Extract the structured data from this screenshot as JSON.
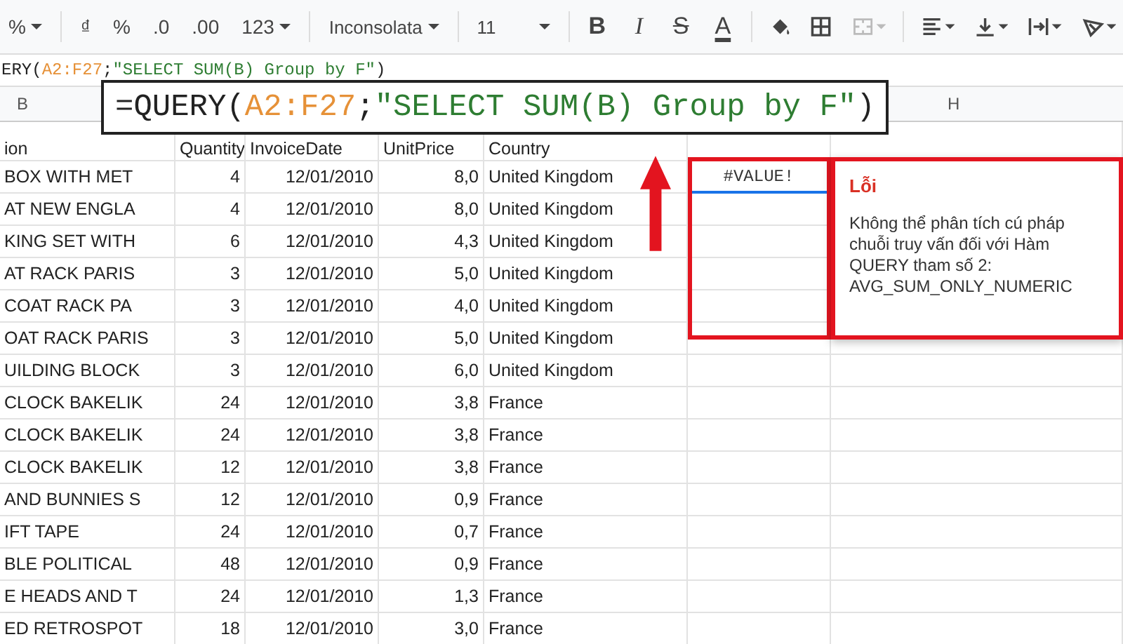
{
  "toolbar": {
    "zoom": "%",
    "number_formats": [
      "₫",
      "%",
      ".0",
      ".00"
    ],
    "format_menu": "123",
    "font": "Inconsolata",
    "font_size": "11",
    "text_styles": [
      "B",
      "I",
      "S",
      "A"
    ],
    "merge": {
      "disabled": true
    }
  },
  "formula_bar": {
    "parts": [
      {
        "kind": "plain",
        "text": "ERY("
      },
      {
        "kind": "range",
        "text": "A2:F27"
      },
      {
        "kind": "plain",
        "text": ";"
      },
      {
        "kind": "string",
        "text": "\"SELECT SUM(B) Group by F\""
      },
      {
        "kind": "plain",
        "text": ")"
      }
    ]
  },
  "callout": {
    "parts": [
      {
        "kind": "plain",
        "text": "=QUERY("
      },
      {
        "kind": "range",
        "text": "A2:F27"
      },
      {
        "kind": "plain",
        "text": ";"
      },
      {
        "kind": "string",
        "text": "\"SELECT SUM(B) Group by F\""
      },
      {
        "kind": "plain",
        "text": ")"
      }
    ]
  },
  "column_headers": [
    {
      "label": "B"
    },
    {
      "label": "H"
    }
  ],
  "table": {
    "columns": [
      "ion",
      "Quantity",
      "InvoiceDate",
      "UnitPrice",
      "Country"
    ],
    "rows": [
      [
        "BOX WITH MET",
        "4",
        "12/01/2010",
        "8,0",
        "United Kingdom"
      ],
      [
        "AT NEW ENGLA",
        "4",
        "12/01/2010",
        "8,0",
        "United Kingdom"
      ],
      [
        "KING SET WITH",
        "6",
        "12/01/2010",
        "4,3",
        "United Kingdom"
      ],
      [
        "AT RACK PARIS",
        "3",
        "12/01/2010",
        "5,0",
        "United Kingdom"
      ],
      [
        "COAT RACK PA",
        "3",
        "12/01/2010",
        "4,0",
        "United Kingdom"
      ],
      [
        "OAT RACK PARIS",
        "3",
        "12/01/2010",
        "5,0",
        "United Kingdom"
      ],
      [
        "UILDING BLOCK",
        "3",
        "12/01/2010",
        "6,0",
        "United Kingdom"
      ],
      [
        "CLOCK BAKELIK",
        "24",
        "12/01/2010",
        "3,8",
        "France"
      ],
      [
        "CLOCK BAKELIK",
        "24",
        "12/01/2010",
        "3,8",
        "France"
      ],
      [
        "CLOCK BAKELIK",
        "12",
        "12/01/2010",
        "3,8",
        "France"
      ],
      [
        "AND BUNNIES S",
        "12",
        "12/01/2010",
        "0,9",
        "France"
      ],
      [
        "IFT TAPE",
        "24",
        "12/01/2010",
        "0,7",
        "France"
      ],
      [
        "BLE POLITICAL",
        "48",
        "12/01/2010",
        "0,9",
        "France"
      ],
      [
        "E HEADS AND T",
        "24",
        "12/01/2010",
        "1,3",
        "France"
      ],
      [
        "ED RETROSPOT",
        "18",
        "12/01/2010",
        "3,0",
        "France"
      ]
    ]
  },
  "error_cell": {
    "value": "#VALUE!"
  },
  "error_tooltip": {
    "title": "Lỗi",
    "message": "Không thể phân tích cú pháp chuỗi truy vấn đối với Hàm QUERY tham số 2: AVG_SUM_ONLY_NUMERIC"
  }
}
